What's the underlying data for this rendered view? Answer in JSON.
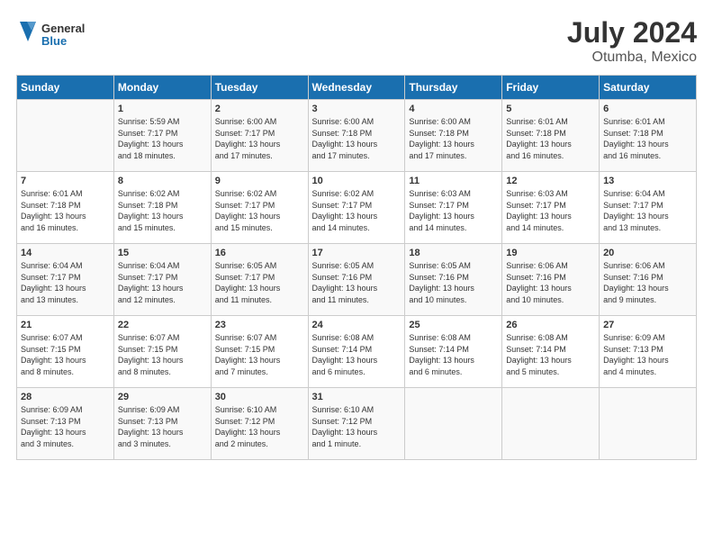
{
  "header": {
    "logo_general": "General",
    "logo_blue": "Blue",
    "month_year": "July 2024",
    "location": "Otumba, Mexico"
  },
  "weekdays": [
    "Sunday",
    "Monday",
    "Tuesday",
    "Wednesday",
    "Thursday",
    "Friday",
    "Saturday"
  ],
  "weeks": [
    [
      {
        "day": "",
        "info": ""
      },
      {
        "day": "1",
        "info": "Sunrise: 5:59 AM\nSunset: 7:17 PM\nDaylight: 13 hours\nand 18 minutes."
      },
      {
        "day": "2",
        "info": "Sunrise: 6:00 AM\nSunset: 7:17 PM\nDaylight: 13 hours\nand 17 minutes."
      },
      {
        "day": "3",
        "info": "Sunrise: 6:00 AM\nSunset: 7:18 PM\nDaylight: 13 hours\nand 17 minutes."
      },
      {
        "day": "4",
        "info": "Sunrise: 6:00 AM\nSunset: 7:18 PM\nDaylight: 13 hours\nand 17 minutes."
      },
      {
        "day": "5",
        "info": "Sunrise: 6:01 AM\nSunset: 7:18 PM\nDaylight: 13 hours\nand 16 minutes."
      },
      {
        "day": "6",
        "info": "Sunrise: 6:01 AM\nSunset: 7:18 PM\nDaylight: 13 hours\nand 16 minutes."
      }
    ],
    [
      {
        "day": "7",
        "info": "Sunrise: 6:01 AM\nSunset: 7:18 PM\nDaylight: 13 hours\nand 16 minutes."
      },
      {
        "day": "8",
        "info": "Sunrise: 6:02 AM\nSunset: 7:18 PM\nDaylight: 13 hours\nand 15 minutes."
      },
      {
        "day": "9",
        "info": "Sunrise: 6:02 AM\nSunset: 7:17 PM\nDaylight: 13 hours\nand 15 minutes."
      },
      {
        "day": "10",
        "info": "Sunrise: 6:02 AM\nSunset: 7:17 PM\nDaylight: 13 hours\nand 14 minutes."
      },
      {
        "day": "11",
        "info": "Sunrise: 6:03 AM\nSunset: 7:17 PM\nDaylight: 13 hours\nand 14 minutes."
      },
      {
        "day": "12",
        "info": "Sunrise: 6:03 AM\nSunset: 7:17 PM\nDaylight: 13 hours\nand 14 minutes."
      },
      {
        "day": "13",
        "info": "Sunrise: 6:04 AM\nSunset: 7:17 PM\nDaylight: 13 hours\nand 13 minutes."
      }
    ],
    [
      {
        "day": "14",
        "info": "Sunrise: 6:04 AM\nSunset: 7:17 PM\nDaylight: 13 hours\nand 13 minutes."
      },
      {
        "day": "15",
        "info": "Sunrise: 6:04 AM\nSunset: 7:17 PM\nDaylight: 13 hours\nand 12 minutes."
      },
      {
        "day": "16",
        "info": "Sunrise: 6:05 AM\nSunset: 7:17 PM\nDaylight: 13 hours\nand 11 minutes."
      },
      {
        "day": "17",
        "info": "Sunrise: 6:05 AM\nSunset: 7:16 PM\nDaylight: 13 hours\nand 11 minutes."
      },
      {
        "day": "18",
        "info": "Sunrise: 6:05 AM\nSunset: 7:16 PM\nDaylight: 13 hours\nand 10 minutes."
      },
      {
        "day": "19",
        "info": "Sunrise: 6:06 AM\nSunset: 7:16 PM\nDaylight: 13 hours\nand 10 minutes."
      },
      {
        "day": "20",
        "info": "Sunrise: 6:06 AM\nSunset: 7:16 PM\nDaylight: 13 hours\nand 9 minutes."
      }
    ],
    [
      {
        "day": "21",
        "info": "Sunrise: 6:07 AM\nSunset: 7:15 PM\nDaylight: 13 hours\nand 8 minutes."
      },
      {
        "day": "22",
        "info": "Sunrise: 6:07 AM\nSunset: 7:15 PM\nDaylight: 13 hours\nand 8 minutes."
      },
      {
        "day": "23",
        "info": "Sunrise: 6:07 AM\nSunset: 7:15 PM\nDaylight: 13 hours\nand 7 minutes."
      },
      {
        "day": "24",
        "info": "Sunrise: 6:08 AM\nSunset: 7:14 PM\nDaylight: 13 hours\nand 6 minutes."
      },
      {
        "day": "25",
        "info": "Sunrise: 6:08 AM\nSunset: 7:14 PM\nDaylight: 13 hours\nand 6 minutes."
      },
      {
        "day": "26",
        "info": "Sunrise: 6:08 AM\nSunset: 7:14 PM\nDaylight: 13 hours\nand 5 minutes."
      },
      {
        "day": "27",
        "info": "Sunrise: 6:09 AM\nSunset: 7:13 PM\nDaylight: 13 hours\nand 4 minutes."
      }
    ],
    [
      {
        "day": "28",
        "info": "Sunrise: 6:09 AM\nSunset: 7:13 PM\nDaylight: 13 hours\nand 3 minutes."
      },
      {
        "day": "29",
        "info": "Sunrise: 6:09 AM\nSunset: 7:13 PM\nDaylight: 13 hours\nand 3 minutes."
      },
      {
        "day": "30",
        "info": "Sunrise: 6:10 AM\nSunset: 7:12 PM\nDaylight: 13 hours\nand 2 minutes."
      },
      {
        "day": "31",
        "info": "Sunrise: 6:10 AM\nSunset: 7:12 PM\nDaylight: 13 hours\nand 1 minute."
      },
      {
        "day": "",
        "info": ""
      },
      {
        "day": "",
        "info": ""
      },
      {
        "day": "",
        "info": ""
      }
    ]
  ]
}
